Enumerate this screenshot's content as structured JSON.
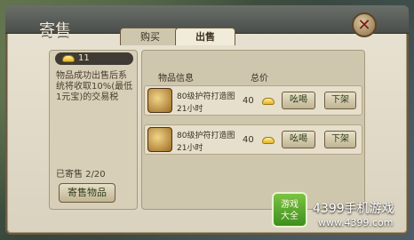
{
  "window": {
    "title": "寄售",
    "close_symbol": "✕"
  },
  "tabs": [
    {
      "label": "购买"
    },
    {
      "label": "出售"
    }
  ],
  "left": {
    "gold_amount": "11",
    "notice": "物品成功出售后系统将收取10%(最低1元宝)的交易税",
    "sold_count": "已寄售  2/20",
    "sell_button": "寄售物品"
  },
  "table": {
    "headers": {
      "info": "物品信息",
      "price": "总价"
    },
    "rows": [
      {
        "name": "80级护符打造图",
        "time": "21小时",
        "price": "40",
        "yell": "吆喝",
        "off": "下架"
      },
      {
        "name": "80级护符打造图",
        "time": "21小时",
        "price": "40",
        "yell": "吆喝",
        "off": "下架"
      }
    ]
  },
  "watermark": {
    "logo_line1": "游戏",
    "logo_line2": "大全",
    "brand": "4399手机游戏",
    "url": "www.4399.com"
  },
  "colors": {
    "accent_gold": "#e2b420",
    "panel": "#d7cfb8",
    "frame_border": "#6b5a40"
  },
  "icons": {
    "currency": "ingot-icon",
    "item": "charm-blueprint-icon",
    "close": "close-icon"
  }
}
